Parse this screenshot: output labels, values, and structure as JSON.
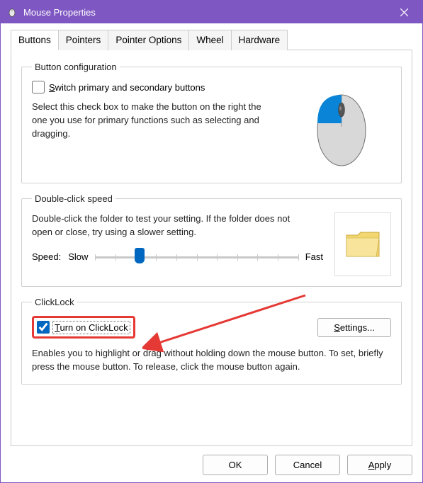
{
  "window": {
    "title": "Mouse Properties"
  },
  "tabs": {
    "buttons": "Buttons",
    "pointers": "Pointers",
    "pointer_options": "Pointer Options",
    "wheel": "Wheel",
    "hardware": "Hardware"
  },
  "button_config": {
    "legend": "Button configuration",
    "switch_label_pre": "S",
    "switch_label_rest": "witch primary and secondary buttons",
    "description": "Select this check box to make the button on the right the one you use for primary functions such as selecting and dragging."
  },
  "dblclick": {
    "legend": "Double-click speed",
    "description": "Double-click the folder to test your setting. If the folder does not open or close, try using a slower setting.",
    "speed_label": "Speed:",
    "slow_label": "Slow",
    "fast_label": "Fast"
  },
  "clicklock": {
    "legend": "ClickLock",
    "turn_on_pre": "T",
    "turn_on_rest": "urn on ClickLock",
    "settings_pre": "S",
    "settings_rest": "ettings...",
    "description": "Enables you to highlight or drag without holding down the mouse button. To set, briefly press the mouse button. To release, click the mouse button again."
  },
  "footer": {
    "ok": "OK",
    "cancel": "Cancel",
    "apply_pre": "A",
    "apply_rest": "pply"
  }
}
